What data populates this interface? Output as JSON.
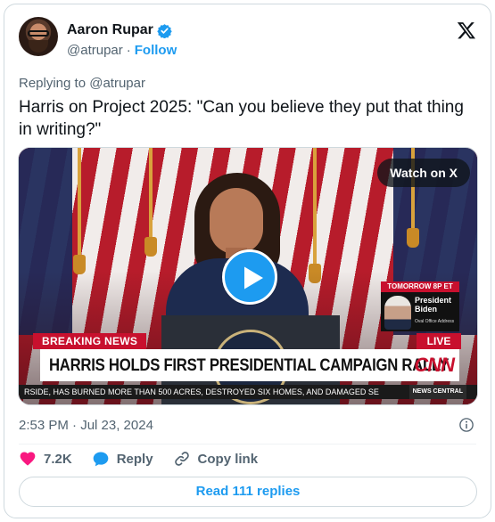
{
  "author": {
    "display_name": "Aaron Rupar",
    "handle": "@atrupar",
    "separator": "·",
    "follow_label": "Follow"
  },
  "tweet": {
    "replying_to": "Replying to @atrupar",
    "text": "Harris on Project 2025: \"Can you believe they put that thing in writing?\"",
    "timestamp": "2:53 PM · Jul 23, 2024"
  },
  "media": {
    "watch_label": "Watch on X",
    "breaking_news": "BREAKING NEWS",
    "live_label": "LIVE",
    "headline": "HARRIS HOLDS FIRST PRESIDENTIAL CAMPAIGN RALLY",
    "network": "CNN",
    "tomorrow_label": "TOMORROW 8P ET",
    "lower_third_name": "President Biden",
    "lower_third_sub": "Oval Office Address",
    "ticker_text": "RSIDE, HAS BURNED MORE THAN 500 ACRES, DESTROYED SIX HOMES, AND DAMAGED SE",
    "ticker_tag": "NEWS CENTRAL"
  },
  "actions": {
    "like_count": "7.2K",
    "reply_label": "Reply",
    "copy_link_label": "Copy link",
    "read_replies_label": "Read 111 replies"
  },
  "colors": {
    "accent": "#1d9bf0",
    "like": "#f91880",
    "text_secondary": "#536471",
    "cnn_red": "#c8102e"
  },
  "icons": [
    "verified-badge-icon",
    "x-logo-icon",
    "play-icon",
    "info-icon",
    "heart-icon",
    "reply-bubble-icon",
    "link-icon"
  ]
}
